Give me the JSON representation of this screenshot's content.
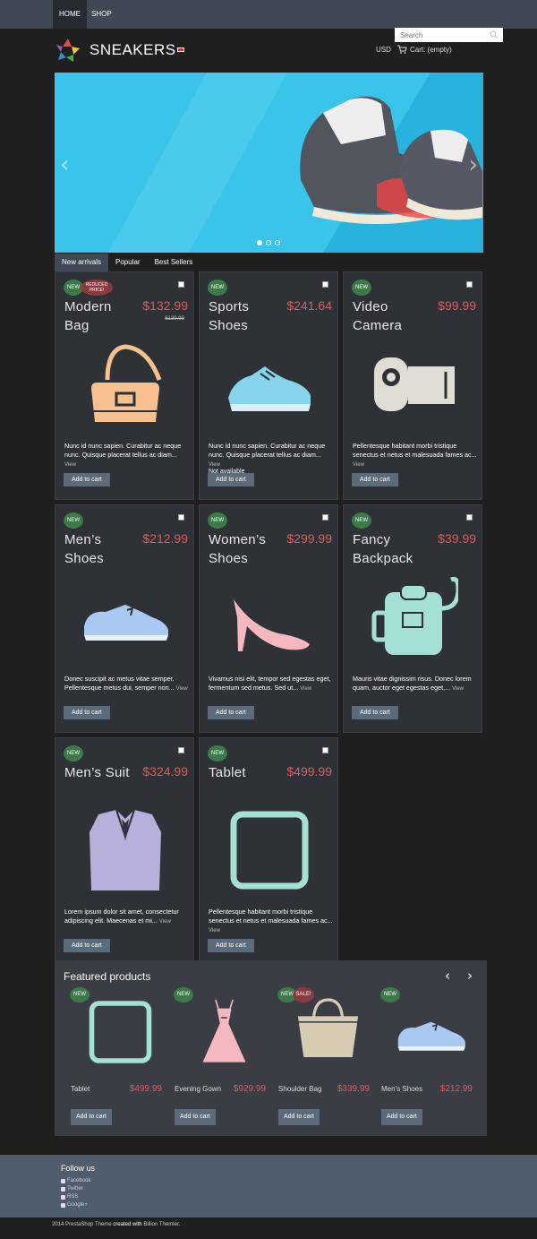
{
  "nav": {
    "home": "HOME",
    "shop": "SHOP"
  },
  "search": {
    "placeholder": "Search"
  },
  "brand": {
    "name": "SNEAKERS"
  },
  "header": {
    "currency": "USD",
    "cart": "Cart: (empty)"
  },
  "slider": {
    "prev": "‹",
    "next": "›"
  },
  "tabs": [
    "New arrivals",
    "Popular",
    "Best Sellers"
  ],
  "products": [
    {
      "name": "Modern Bag",
      "price": "$132.99",
      "old_price": "$139.99",
      "badge": "NEW",
      "badge2": "REDUCED PRICE!",
      "desc": "Nunc id nunc sapien. Curabitur ac neque nunc. Quisque placerat tellus ac diam...",
      "view": "View",
      "availability": "",
      "button": "Add to cart",
      "icon": "bag-icon",
      "color": "#f7c08f"
    },
    {
      "name": "Sports Shoes",
      "price": "$241.64",
      "old_price": "",
      "badge": "NEW",
      "badge2": "",
      "desc": "Nunc id nunc sapien. Curabitur ac neque nunc. Quisque placerat tellus ac diam...",
      "view": "View",
      "availability": "Not available",
      "button": "Add to cart",
      "icon": "sneaker-icon",
      "color": "#85d4ec"
    },
    {
      "name": "Video Camera",
      "price": "$99.99",
      "old_price": "",
      "badge": "NEW",
      "badge2": "",
      "desc": "Pellentesque habitant morbi tristique senectus et netus et malesuada fames ac...",
      "view": "View",
      "availability": "",
      "button": "Add to cart",
      "icon": "camera-icon",
      "color": "#e0ddd4"
    },
    {
      "name": "Men’s Shoes",
      "price": "$212.99",
      "old_price": "",
      "badge": "NEW",
      "badge2": "",
      "desc": "Donec suscipit ac metus vitae semper. Pellentesque metus dui, semper non...",
      "view": "View",
      "availability": "",
      "button": "Add to cart",
      "icon": "shoe-icon",
      "color": "#a9c9f2"
    },
    {
      "name": "Women’s Shoes",
      "price": "$299.99",
      "old_price": "",
      "badge": "NEW",
      "badge2": "",
      "desc": "Vivamus nisi elit, tempor sed egestas eget, fermentum sed metus. Sed ut...",
      "view": "View",
      "availability": "",
      "button": "Add to cart",
      "icon": "heel-icon",
      "color": "#f5b8bf"
    },
    {
      "name": "Fancy Backpack",
      "price": "$39.99",
      "old_price": "",
      "badge": "NEW",
      "badge2": "",
      "desc": "Mauris vitae dignissim risus. Donec lorem quam, auctor eget egestas eget,...",
      "view": "View",
      "availability": "",
      "button": "Add to cart",
      "icon": "backpack-icon",
      "color": "#a4e0d6"
    },
    {
      "name": "Men’s Suit",
      "price": "$324.99",
      "old_price": "",
      "badge": "NEW",
      "badge2": "",
      "desc": "Lorem ipsum dolor sit amet, consectetur adipiscing elit. Maecenas et mi...",
      "view": "View",
      "availability": "",
      "button": "Add to cart",
      "icon": "suit-icon",
      "color": "#b5b0dc"
    },
    {
      "name": "Tablet",
      "price": "$499.99",
      "old_price": "",
      "badge": "NEW",
      "badge2": "",
      "desc": "Pellentesque habitant morbi tristique senectus et netus et malesuada fames ac...",
      "view": "View",
      "availability": "",
      "button": "Add to cart",
      "icon": "tablet-icon",
      "color": "#a4e0d6"
    }
  ],
  "featured": {
    "title": "Featured products",
    "prev": "‹",
    "next": "›",
    "items": [
      {
        "name": "Tablet",
        "price": "$499.99",
        "badge": "NEW",
        "badge2": "",
        "button": "Add to cart",
        "icon": "tablet-icon"
      },
      {
        "name": "Evening Gown",
        "price": "$929.99",
        "badge": "NEW",
        "badge2": "",
        "button": "Add to cart",
        "icon": "dress-icon"
      },
      {
        "name": "Shoulder Bag",
        "price": "$339.99",
        "badge": "NEW",
        "badge2": "SALE!",
        "button": "Add to cart",
        "icon": "handbag-icon"
      },
      {
        "name": "Men’s Shoes",
        "price": "$212.99",
        "badge": "NEW",
        "badge2": "",
        "button": "Add to cart",
        "icon": "shoe-icon"
      }
    ]
  },
  "footer": {
    "follow": "Follow us",
    "links": [
      "Facebook",
      "Twitter",
      "RSS",
      "Google+"
    ],
    "copy_pre": "2014",
    "copy_theme": "PrestaShop Theme",
    "copy_mid": "created with",
    "copy_author": "Billion Themler",
    "copy_end": "."
  }
}
